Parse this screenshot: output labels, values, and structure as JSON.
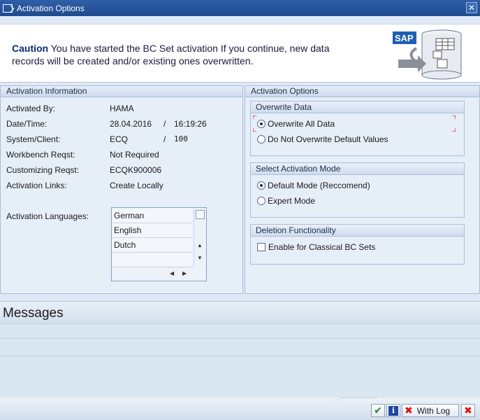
{
  "window": {
    "title": "Activation Options",
    "close_symbol": "✕"
  },
  "caution": {
    "bold": "Caution",
    "message": " You have started the BC Set activation If you continue, new data records will be created and/or existing ones overwritten.",
    "logo_text": "SAP"
  },
  "activation_info": {
    "header": "Activation Information",
    "activated_by_label": "Activated By:",
    "activated_by_value": "HAMA",
    "date_time_label": "Date/Time:",
    "date_value": "28.04.2016",
    "date_sep": "/",
    "time_value": "16:19:26",
    "system_client_label": "System/Client:",
    "system_value": "ECQ",
    "client_sep": "/",
    "client_value": "100",
    "workbench_label": "Workbench Reqst:",
    "workbench_value": "Not Required",
    "customizing_label": "Customizing Reqst:",
    "customizing_value": "ECQK900006",
    "links_label": "Activation Links:",
    "links_value": "Create Locally",
    "languages_label": "Activation Languages:",
    "languages": [
      "German",
      "English",
      "Dutch"
    ]
  },
  "activation_options": {
    "header": "Activation Options",
    "overwrite": {
      "header": "Overwrite Data",
      "options": [
        "Overwrite All Data",
        "Do Not Overwrite Default Values"
      ],
      "selected": "Overwrite All Data"
    },
    "mode": {
      "header": "Select Activation Mode",
      "options": [
        "Default Mode (Reccomend)",
        "Expert Mode"
      ],
      "selected": "Default Mode (Reccomend)"
    },
    "deletion": {
      "header": "Deletion Functionality",
      "checkbox_label": "Enable for Classical BC Sets",
      "checked": false
    }
  },
  "messages": {
    "header": "Messages"
  },
  "footer": {
    "ok_symbol": "✔",
    "info_symbol": "i",
    "with_log_label": "With Log",
    "with_log_symbol": "✖",
    "cancel_symbol": "✖"
  },
  "colors": {
    "title_bar": "#1f4a8e",
    "panel_bg": "#e6eef8",
    "ok_green": "#1c8a1c",
    "cancel_red": "#d11111"
  }
}
